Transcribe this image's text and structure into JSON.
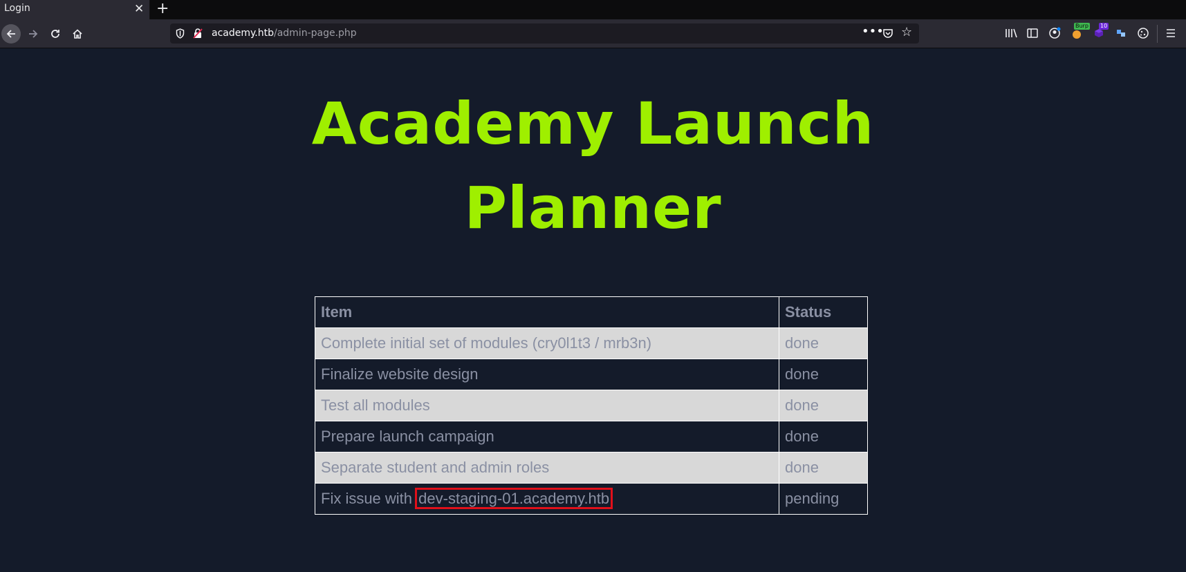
{
  "browser": {
    "tab_title": "Login",
    "tab_close": "✕",
    "new_tab": "+",
    "url_domain": "academy.htb",
    "url_path": "/admin-page.php",
    "url_more": "•••",
    "toolbar_badges": {
      "burp": "Burp",
      "count": "10"
    }
  },
  "page": {
    "title_line1": "Academy Launch",
    "title_line2": "Planner",
    "title_color": "#9fef00"
  },
  "table": {
    "headers": {
      "item": "Item",
      "status": "Status"
    },
    "rows": [
      {
        "item": "Complete initial set of modules (cry0l1t3 / mrb3n)",
        "status": "done"
      },
      {
        "item": "Finalize website design",
        "status": "done"
      },
      {
        "item": "Test all modules",
        "status": "done"
      },
      {
        "item": "Prepare launch campaign",
        "status": "done"
      },
      {
        "item": "Separate student and admin roles",
        "status": "done"
      },
      {
        "item_prefix": "Fix issue with ",
        "item_highlight": "dev-staging-01.academy.htb",
        "status": "pending"
      }
    ]
  }
}
